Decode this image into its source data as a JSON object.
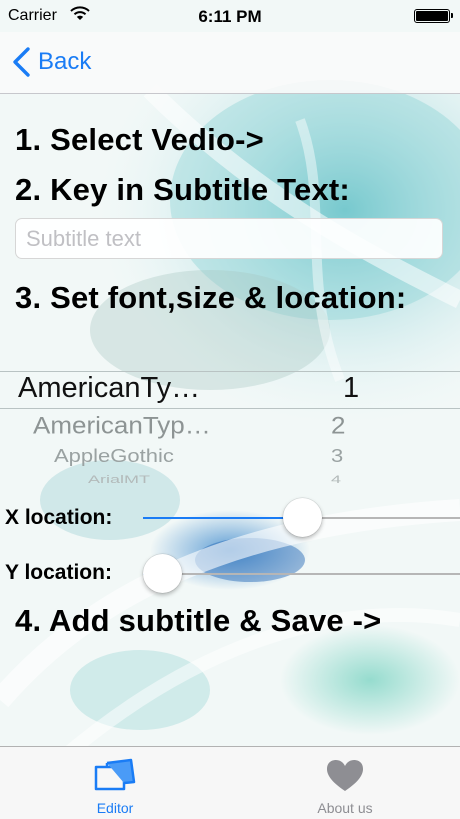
{
  "status_bar": {
    "carrier": "Carrier",
    "time": "6:11 PM",
    "icons": [
      "wifi-icon",
      "battery-icon"
    ]
  },
  "nav": {
    "back_label": "Back",
    "back_icon": "chevron-left-icon"
  },
  "steps": {
    "step1": "1. Select Vedio->",
    "step2": "2. Key in Subtitle Text:",
    "step3": "3. Set font,size & location:",
    "step4": "4. Add subtitle & Save ->"
  },
  "subtitle_input": {
    "placeholder": "Subtitle text",
    "value": ""
  },
  "picker": {
    "fonts": [
      "AmericanTy…",
      "AmericanTyp…",
      "AppleGothic",
      "ArialMT"
    ],
    "sizes": [
      "1",
      "2",
      "3",
      "4"
    ],
    "selected_font": "AmericanTy…",
    "selected_size": "1"
  },
  "x_location": {
    "label": "X location:",
    "value_fraction": 0.5
  },
  "y_location": {
    "label": "Y location:",
    "value_fraction": 0.0
  },
  "tabs": [
    {
      "label": "Editor",
      "icon": "editor-tab-icon",
      "selected": true
    },
    {
      "label": "About us",
      "icon": "heart-icon",
      "selected": false
    }
  ],
  "colors": {
    "accent": "#1a7cf5",
    "tab_inactive": "#8e8e93",
    "track": "#b6b6b6"
  }
}
